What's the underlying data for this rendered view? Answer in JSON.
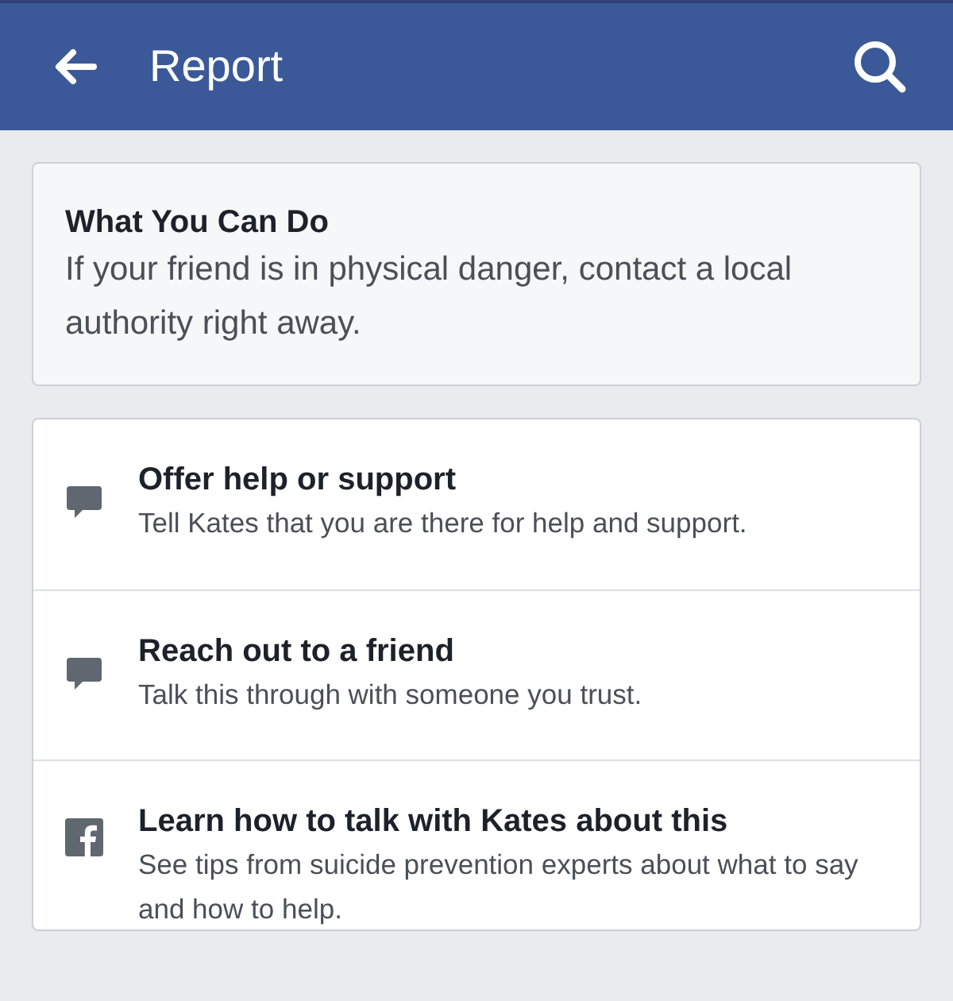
{
  "header": {
    "title": "Report"
  },
  "info_card": {
    "title": "What You Can Do",
    "text": "If your friend is in physical danger, contact a local authority right away."
  },
  "options": [
    {
      "kind": "chat",
      "title": "Offer help or support",
      "text": "Tell Kates that you are there for help and support."
    },
    {
      "kind": "chat",
      "title": "Reach out to a friend",
      "text": "Talk this through with someone you trust."
    },
    {
      "kind": "letter",
      "title": "Learn how to talk with Kates about this",
      "text": "See tips from suicide prevention experts about what to say and how to help."
    }
  ]
}
